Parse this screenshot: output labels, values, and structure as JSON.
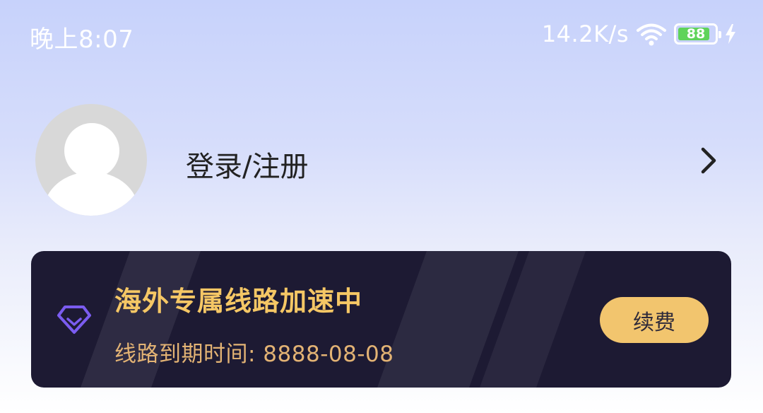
{
  "status_bar": {
    "time": "晚上8:07",
    "net_speed": "14.2K/s",
    "battery_level": "88",
    "battery_fraction": 0.88,
    "icons": [
      "wifi-icon",
      "battery-icon",
      "charging-bolt-icon"
    ]
  },
  "profile": {
    "login_label": "登录/注册",
    "icons": [
      "default-avatar",
      "chevron-right-icon"
    ]
  },
  "vip_card": {
    "title": "海外专属线路加速中",
    "expiry": "线路到期时间: 8888-08-08",
    "renew_label": "续费",
    "icon": "diamond-icon"
  },
  "colors": {
    "card_background": "#1d1a33",
    "gold_title": "#f5c765",
    "gold_text": "#e3b374",
    "renew_button": "#f2c56e",
    "diamond": "#7b5cf0",
    "battery_green": "#5fd35a"
  }
}
